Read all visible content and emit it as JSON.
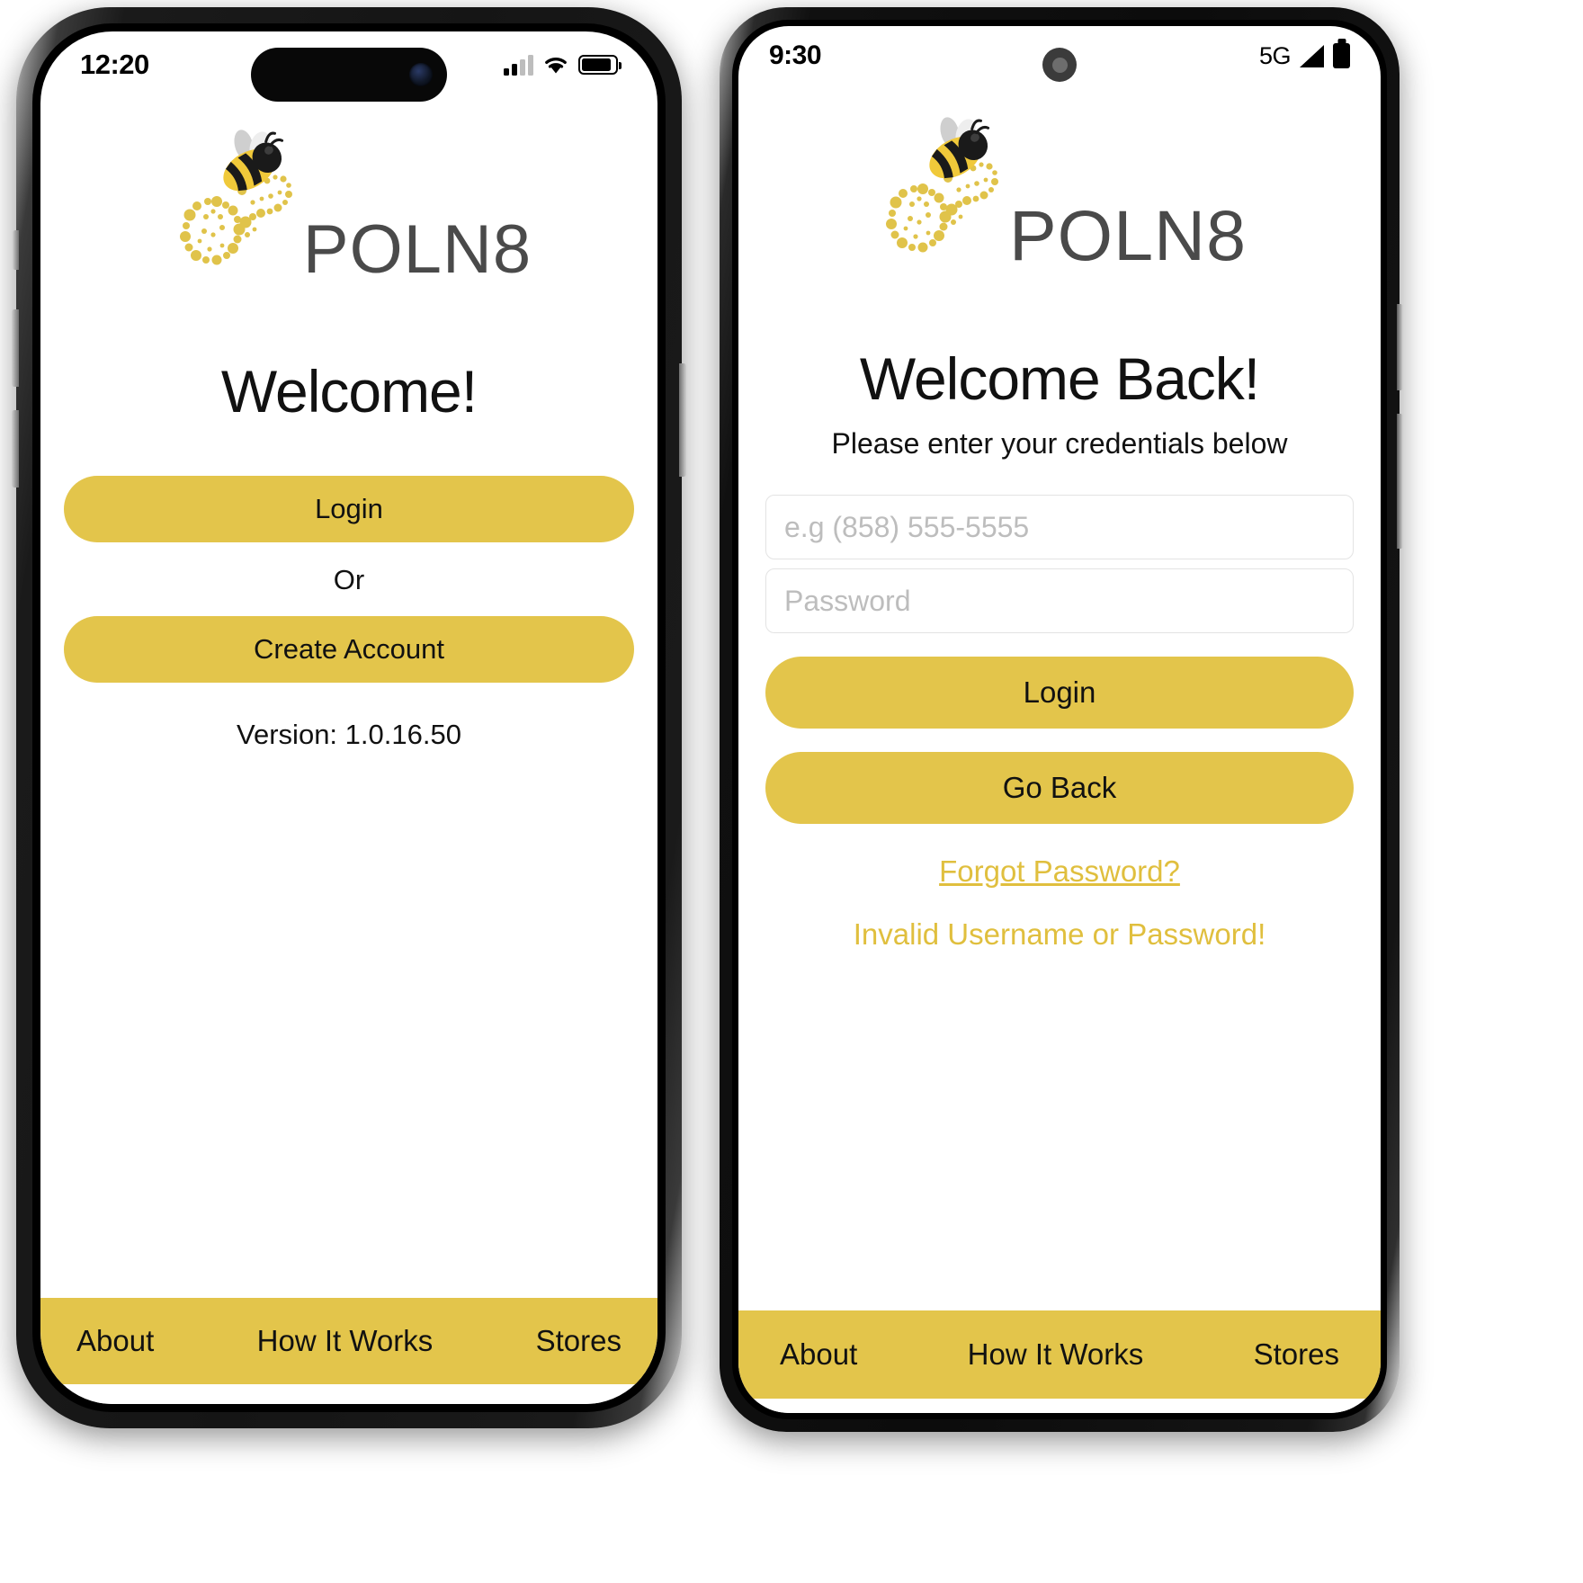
{
  "brand": {
    "name": "POLN8",
    "logo_icon": "bee-with-pollen-trail-logo",
    "accent_color": "#e3c54b",
    "link_color": "#e0bf3e",
    "logo_text_color": "#4a4a4a"
  },
  "phone_left": {
    "device": "iphone",
    "status_bar": {
      "time": "12:20",
      "cellular_icon": "signal-bars-icon",
      "wifi_icon": "wifi-icon",
      "battery_icon": "battery-full-icon",
      "camera_icon": "dynamic-island-camera-icon"
    },
    "screen": {
      "heading": "Welcome!",
      "login_label": "Login",
      "or_label": "Or",
      "create_account_label": "Create Account",
      "version_label": "Version: 1.0.16.50"
    },
    "footer": {
      "about": "About",
      "how_it_works": "How It Works",
      "stores": "Stores"
    }
  },
  "phone_right": {
    "device": "android",
    "status_bar": {
      "time": "9:30",
      "network_label": "5G",
      "signal_icon": "signal-triangle-icon",
      "battery_icon": "battery-full-icon",
      "camera_icon": "punch-hole-camera-icon"
    },
    "screen": {
      "heading": "Welcome Back!",
      "subheading": "Please enter your credentials below",
      "phone_field": {
        "value": "",
        "placeholder": "e.g (858) 555-5555"
      },
      "password_field": {
        "value": "",
        "placeholder": "Password"
      },
      "login_label": "Login",
      "go_back_label": "Go Back",
      "forgot_password_label": "Forgot Password?",
      "error_message": "Invalid Username or Password!"
    },
    "footer": {
      "about": "About",
      "how_it_works": "How It Works",
      "stores": "Stores"
    }
  }
}
